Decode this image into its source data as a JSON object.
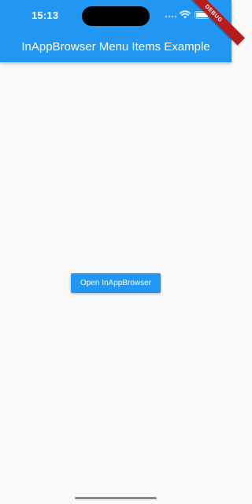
{
  "status_bar": {
    "time": "15:13",
    "signal_icon": "cellular-signal-icon",
    "wifi_icon": "wifi-icon",
    "battery_icon": "battery-icon"
  },
  "debug_banner": {
    "label": "DEBUG"
  },
  "app_bar": {
    "title": "InAppBrowser Menu Items Example",
    "color": "#2196f3"
  },
  "main": {
    "open_button_label": "Open InAppBrowser"
  },
  "colors": {
    "primary": "#2196f3",
    "background": "#fafafa",
    "debug": "#b71c1c"
  }
}
